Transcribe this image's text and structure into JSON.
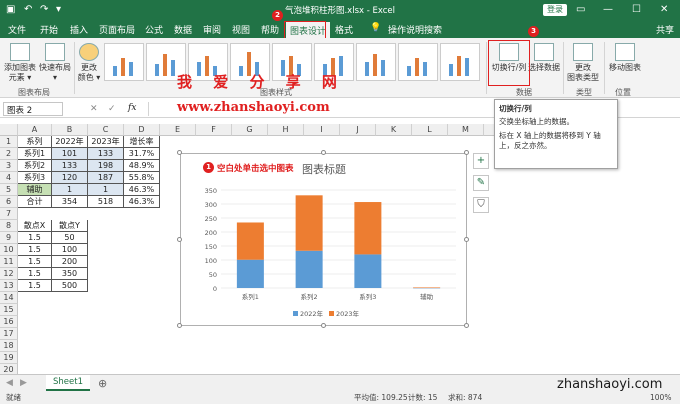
{
  "window": {
    "title": "气泡堆积柱形图.xlsx - Excel",
    "login": "登录"
  },
  "tabs": [
    "文件",
    "开始",
    "插入",
    "页面布局",
    "公式",
    "数据",
    "审阅",
    "视图",
    "帮助",
    "图表设计",
    "格式"
  ],
  "tell_me": "操作说明搜索",
  "share": "共享",
  "ribbon": {
    "add_element": "添加图表\n元素 ▾",
    "quick_layout": "快速布局\n▾",
    "change_color": "更改\n颜色 ▾",
    "switch_rowcol": "切换行/列",
    "select_data": "选择数据",
    "change_type": "更改\n图表类型",
    "move_chart": "移动图表",
    "group_layout": "图表布局",
    "group_style": "图表样式",
    "group_data": "数据",
    "group_type": "类型",
    "group_location": "位置"
  },
  "badges": [
    "2",
    "3",
    "1"
  ],
  "watermark": {
    "cn": "我 爱 分 享 网",
    "url": "www.zhanshaoyi.com",
    "bottom": "zhanshaoyi.com"
  },
  "namebox": "图表 2",
  "fx": "fx",
  "tooltip": {
    "title": "切换行/列",
    "l1": "交换坐标轴上的数据。",
    "l2": "标在 X 轴上的数据将移到 Y 轴上，反之亦然。"
  },
  "columns": [
    "A",
    "B",
    "C",
    "D",
    "E",
    "F",
    "G",
    "H",
    "I",
    "J",
    "K",
    "L",
    "M",
    "N"
  ],
  "rows": [
    "1",
    "2",
    "3",
    "4",
    "5",
    "6",
    "7",
    "8",
    "9",
    "10",
    "11",
    "12",
    "13",
    "14",
    "15",
    "16",
    "17",
    "18",
    "19",
    "20"
  ],
  "table1": [
    [
      "系列",
      "2022年",
      "2023年",
      "增长率"
    ],
    [
      "系列1",
      "101",
      "133",
      "31.7%"
    ],
    [
      "系列2",
      "133",
      "198",
      "48.9%"
    ],
    [
      "系列3",
      "120",
      "187",
      "55.8%"
    ],
    [
      "辅助",
      "1",
      "1",
      "46.3%"
    ],
    [
      "合计",
      "354",
      "518",
      "46.3%"
    ]
  ],
  "table2": [
    [
      "散点X",
      "散点Y"
    ],
    [
      "1.5",
      "50"
    ],
    [
      "1.5",
      "100"
    ],
    [
      "1.5",
      "200"
    ],
    [
      "1.5",
      "350"
    ],
    [
      "1.5",
      "500"
    ]
  ],
  "chart_annotation": "空白处单击选中图表",
  "chart_data": {
    "type": "bar",
    "stacked": true,
    "title": "图表标题",
    "categories": [
      "系列1",
      "系列2",
      "系列3",
      "辅助"
    ],
    "series": [
      {
        "name": "2022年",
        "values": [
          101,
          133,
          120,
          1
        ],
        "color": "#5b9bd5"
      },
      {
        "name": "2023年",
        "values": [
          133,
          198,
          187,
          1
        ],
        "color": "#ed7d31"
      }
    ],
    "ylim": [
      0,
      350
    ],
    "yticks": [
      "0",
      "50",
      "100",
      "150",
      "200",
      "250",
      "300",
      "350"
    ],
    "legend": "bottom"
  },
  "sheet": "Sheet1",
  "status": {
    "ready": "就绪",
    "avg": "平均值: 109.25",
    "count": "计数: 15",
    "sum": "求和: 874",
    "zoom": "100%"
  }
}
